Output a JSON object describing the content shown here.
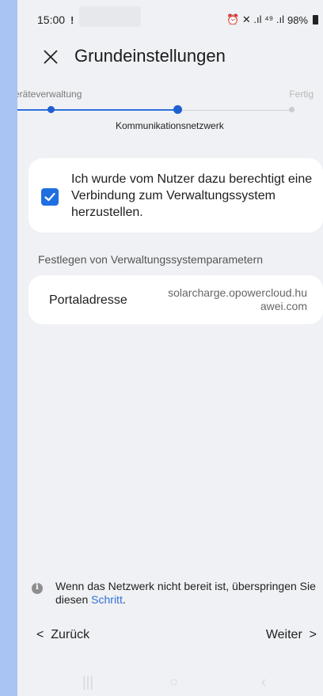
{
  "status_bar": {
    "time": "15:00",
    "notif": "!",
    "icons": "⏰ ✕ .ıl ⁴⁹ .ıl",
    "battery": "98%"
  },
  "header": {
    "title": "Grundeinstellungen"
  },
  "stepper": {
    "step_left": "eräteverwaltung",
    "step_current": "Kommunikationsnetzwerk",
    "step_right": "Fertig"
  },
  "consent": {
    "checked": true,
    "text": "Ich wurde vom Nutzer dazu berechtigt eine Verbindung zum Verwaltungssystem herzustellen."
  },
  "section": {
    "label": "Festlegen von Verwaltungssystemparametern"
  },
  "portal": {
    "label": "Portaladresse",
    "value": "solarcharge.opowercloud.huawei.com"
  },
  "hint": {
    "text": "Wenn das Netzwerk nicht bereit ist, überspringen Sie diesen ",
    "link": "Schritt",
    "suffix": "."
  },
  "nav": {
    "back": "Zurück",
    "next": "Weiter"
  },
  "system_nav": {
    "recent": "|||",
    "home": "○",
    "back": "‹"
  },
  "colors": {
    "accent": "#1f6fe0",
    "background": "#f0f1f4",
    "card": "#ffffff"
  }
}
